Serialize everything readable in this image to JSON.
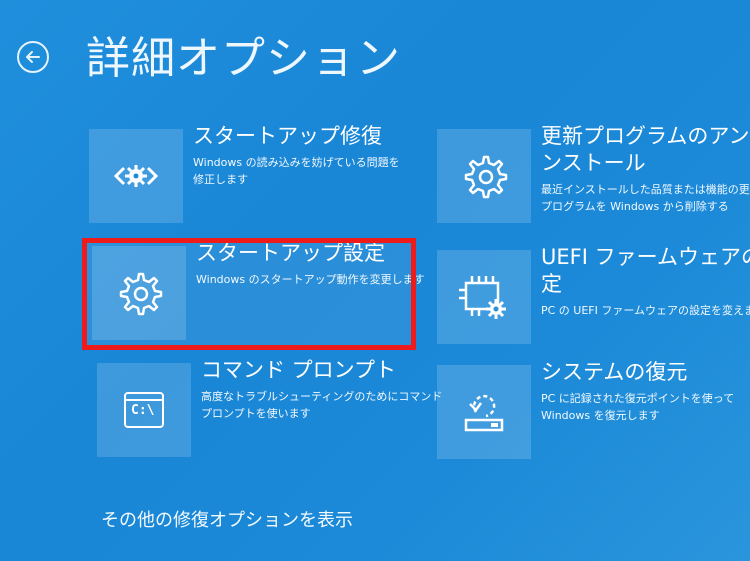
{
  "page": {
    "title": "詳細オプション",
    "back_icon": "back-arrow-icon"
  },
  "options": [
    {
      "id": "startup-repair",
      "title": "スタートアップ修復",
      "desc": [
        "Windows の読み込みを妨げている問題を",
        "修正します"
      ],
      "icon": "code-gear-icon"
    },
    {
      "id": "uninstall-updates",
      "title": [
        "更新プログラムのアンイ",
        "ンストール"
      ],
      "desc": [
        "最近インストールした品質または機能の更新",
        "プログラムを Windows から削除する"
      ],
      "icon": "gear-icon"
    },
    {
      "id": "startup-settings",
      "title": "スタートアップ設定",
      "desc": [
        "Windows のスタートアップ動作を変更します"
      ],
      "icon": "gear-icon",
      "selected": true
    },
    {
      "id": "uefi-settings",
      "title": [
        "UEFI ファームウェアの設",
        "定"
      ],
      "desc": [
        "PC の UEFI ファームウェアの設定を変えます"
      ],
      "icon": "chip-gear-icon"
    },
    {
      "id": "command-prompt",
      "title": "コマンド プロンプト",
      "desc": [
        "高度なトラブルシューティングのためにコマンド",
        "プロンプトを使います"
      ],
      "icon": "command-prompt-icon",
      "icon_text": "C:\\"
    },
    {
      "id": "system-restore",
      "title": "システムの復元",
      "desc": [
        "PC に記録された復元ポイントを使って",
        "Windows を復元します"
      ],
      "icon": "system-restore-icon"
    }
  ],
  "more_options_label": "その他の修復オプションを表示",
  "colors": {
    "background": "#1c8ad8",
    "highlight_border": "#ee1b1b",
    "text": "#ffffff"
  }
}
